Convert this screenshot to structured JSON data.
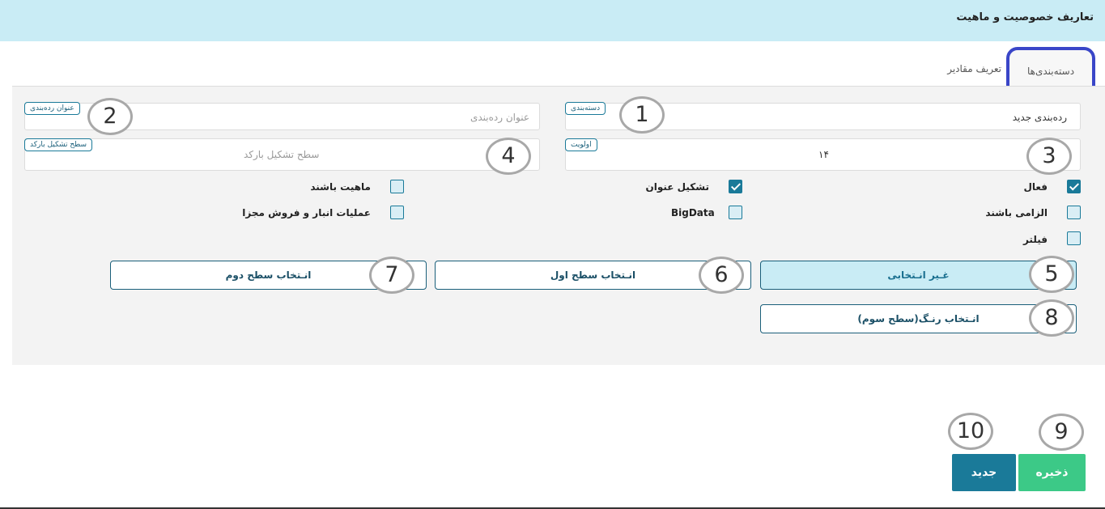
{
  "header": {
    "title": "تعاریف خصوصیت و ماهیت"
  },
  "tabs": [
    {
      "label": "دسته‌بندی‌ها",
      "active": true
    },
    {
      "label": "تعریف مقادیر",
      "active": false
    }
  ],
  "form": {
    "category": {
      "badge": "دسته‌بندی",
      "value": "رده‌بندی جدید",
      "marker": "1"
    },
    "classification_title": {
      "badge": "عنوان رده‌بندی",
      "placeholder": "عنوان رده‌بندی",
      "marker": "2"
    },
    "priority": {
      "badge": "اولویت",
      "value": "۱۴",
      "marker": "3"
    },
    "barcode_level": {
      "badge": "سطح تشکیل بارکد",
      "placeholder": "سطح تشکیل بارکد",
      "marker": "4"
    }
  },
  "checkboxes": {
    "active": {
      "label": "فعال",
      "checked": true
    },
    "title_formation": {
      "label": "تشکیل عنوان",
      "checked": true
    },
    "is_nature": {
      "label": "ماهیت باشند",
      "checked": false
    },
    "mandatory": {
      "label": "الزامی باشند",
      "checked": false
    },
    "bigdata": {
      "label": "BigData",
      "checked": false
    },
    "separate_ops": {
      "label": "عملیات انبار و فروش مجزا",
      "checked": false
    },
    "filter": {
      "label": "فیلتر",
      "checked": false
    }
  },
  "level_buttons": {
    "non_selective": {
      "label": "غـیر انـتخابی",
      "marker": "5",
      "selected": true
    },
    "first_level": {
      "label": "انـتخاب سطح اول",
      "marker": "6"
    },
    "second_level": {
      "label": "انـتخاب سطح دوم",
      "marker": "7"
    },
    "color_third": {
      "label": "انـتخاب رنـگ(سطح سوم)",
      "marker": "8"
    }
  },
  "actions": {
    "save": {
      "label": "ذخیره",
      "marker": "9"
    },
    "new": {
      "label": "جدید",
      "marker": "10"
    }
  },
  "colors": {
    "header_bg": "#c9ecf5",
    "accent": "#1a7a99",
    "highlight": "#3a46c8",
    "save": "#3cc987"
  }
}
